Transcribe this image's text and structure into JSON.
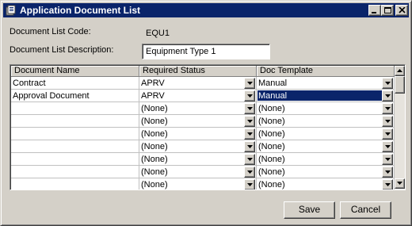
{
  "window": {
    "title": "Application Document List",
    "icon": "document-list-icon"
  },
  "form": {
    "code_label": "Document List Code:",
    "code_value": "EQU1",
    "desc_label": "Document List Description:",
    "desc_value": "Equipment Type 1"
  },
  "grid": {
    "headers": [
      "Document Name",
      "Required Status",
      "Doc Template"
    ],
    "rows": [
      {
        "name": "Contract",
        "status": "APRV",
        "template": "Manual"
      },
      {
        "name": "Approval Document",
        "status": "APRV",
        "template": "Manual"
      },
      {
        "name": "",
        "status": "(None)",
        "template": "(None)"
      },
      {
        "name": "",
        "status": "(None)",
        "template": "(None)"
      },
      {
        "name": "",
        "status": "(None)",
        "template": "(None)"
      },
      {
        "name": "",
        "status": "(None)",
        "template": "(None)"
      },
      {
        "name": "",
        "status": "(None)",
        "template": "(None)"
      },
      {
        "name": "",
        "status": "(None)",
        "template": "(None)"
      },
      {
        "name": "",
        "status": "(None)",
        "template": "(None)"
      }
    ],
    "selected_row": 1,
    "selected_column": "template"
  },
  "buttons": {
    "save": "Save",
    "cancel": "Cancel"
  },
  "colors": {
    "title_bar": "#0a246a",
    "selection": "#0a246a",
    "face": "#d4d0c8"
  }
}
